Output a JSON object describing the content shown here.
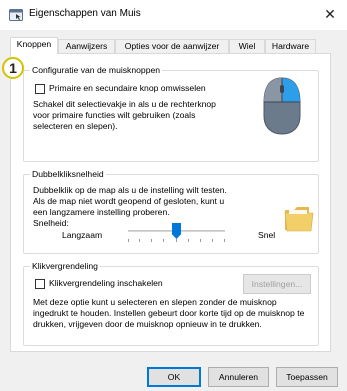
{
  "window": {
    "title": "Eigenschappen van Muis",
    "close_glyph": "✕"
  },
  "tabs": [
    {
      "label": "Knoppen",
      "active": true
    },
    {
      "label": "Aanwijzers",
      "active": false
    },
    {
      "label": "Opties voor de aanwijzer",
      "active": false
    },
    {
      "label": "Wiel",
      "active": false
    },
    {
      "label": "Hardware",
      "active": false
    }
  ],
  "badge": {
    "number": "1"
  },
  "button_config": {
    "legend": "Configuratie van de muisknoppen",
    "checkbox_label": "Primaire en secundaire knop omwisselen",
    "checked": false,
    "description": [
      "Schakel dit selectievakje in als u de rechterknop",
      "voor primaire functies wilt gebruiken (zoals",
      "selecteren en slepen)."
    ],
    "icon": "mouse-illustration-icon"
  },
  "double_click": {
    "legend": "Dubbelkliksnelheid",
    "description": [
      "Dubbelklik op de map als u de instelling wilt testen.",
      "Als de map niet wordt geopend of gesloten, kunt u",
      "een langzamere instelling proberen."
    ],
    "speed_label": "Snelheid:",
    "slow_label": "Langzaam",
    "fast_label": "Snel",
    "speed_value_percent": 50,
    "icon": "folder-icon"
  },
  "click_lock": {
    "legend": "Klikvergrendeling",
    "checkbox_label": "Klikvergrendeling inschakelen",
    "checked": false,
    "settings_button": "Instellingen...",
    "description": [
      "Met deze optie kunt u selecteren en slepen zonder de muisknop",
      "ingedrukt te houden. Instellen gebeurt door korte tijd op de muisknop te",
      "drukken, vrijgeven door de muisknop opnieuw in te drukken."
    ]
  },
  "footer": {
    "ok": "OK",
    "cancel": "Annuleren",
    "apply": "Toepassen"
  },
  "colors": {
    "accent": "#0078d7",
    "badge_ring": "#d4c200",
    "folder": "#f3cf6a"
  }
}
